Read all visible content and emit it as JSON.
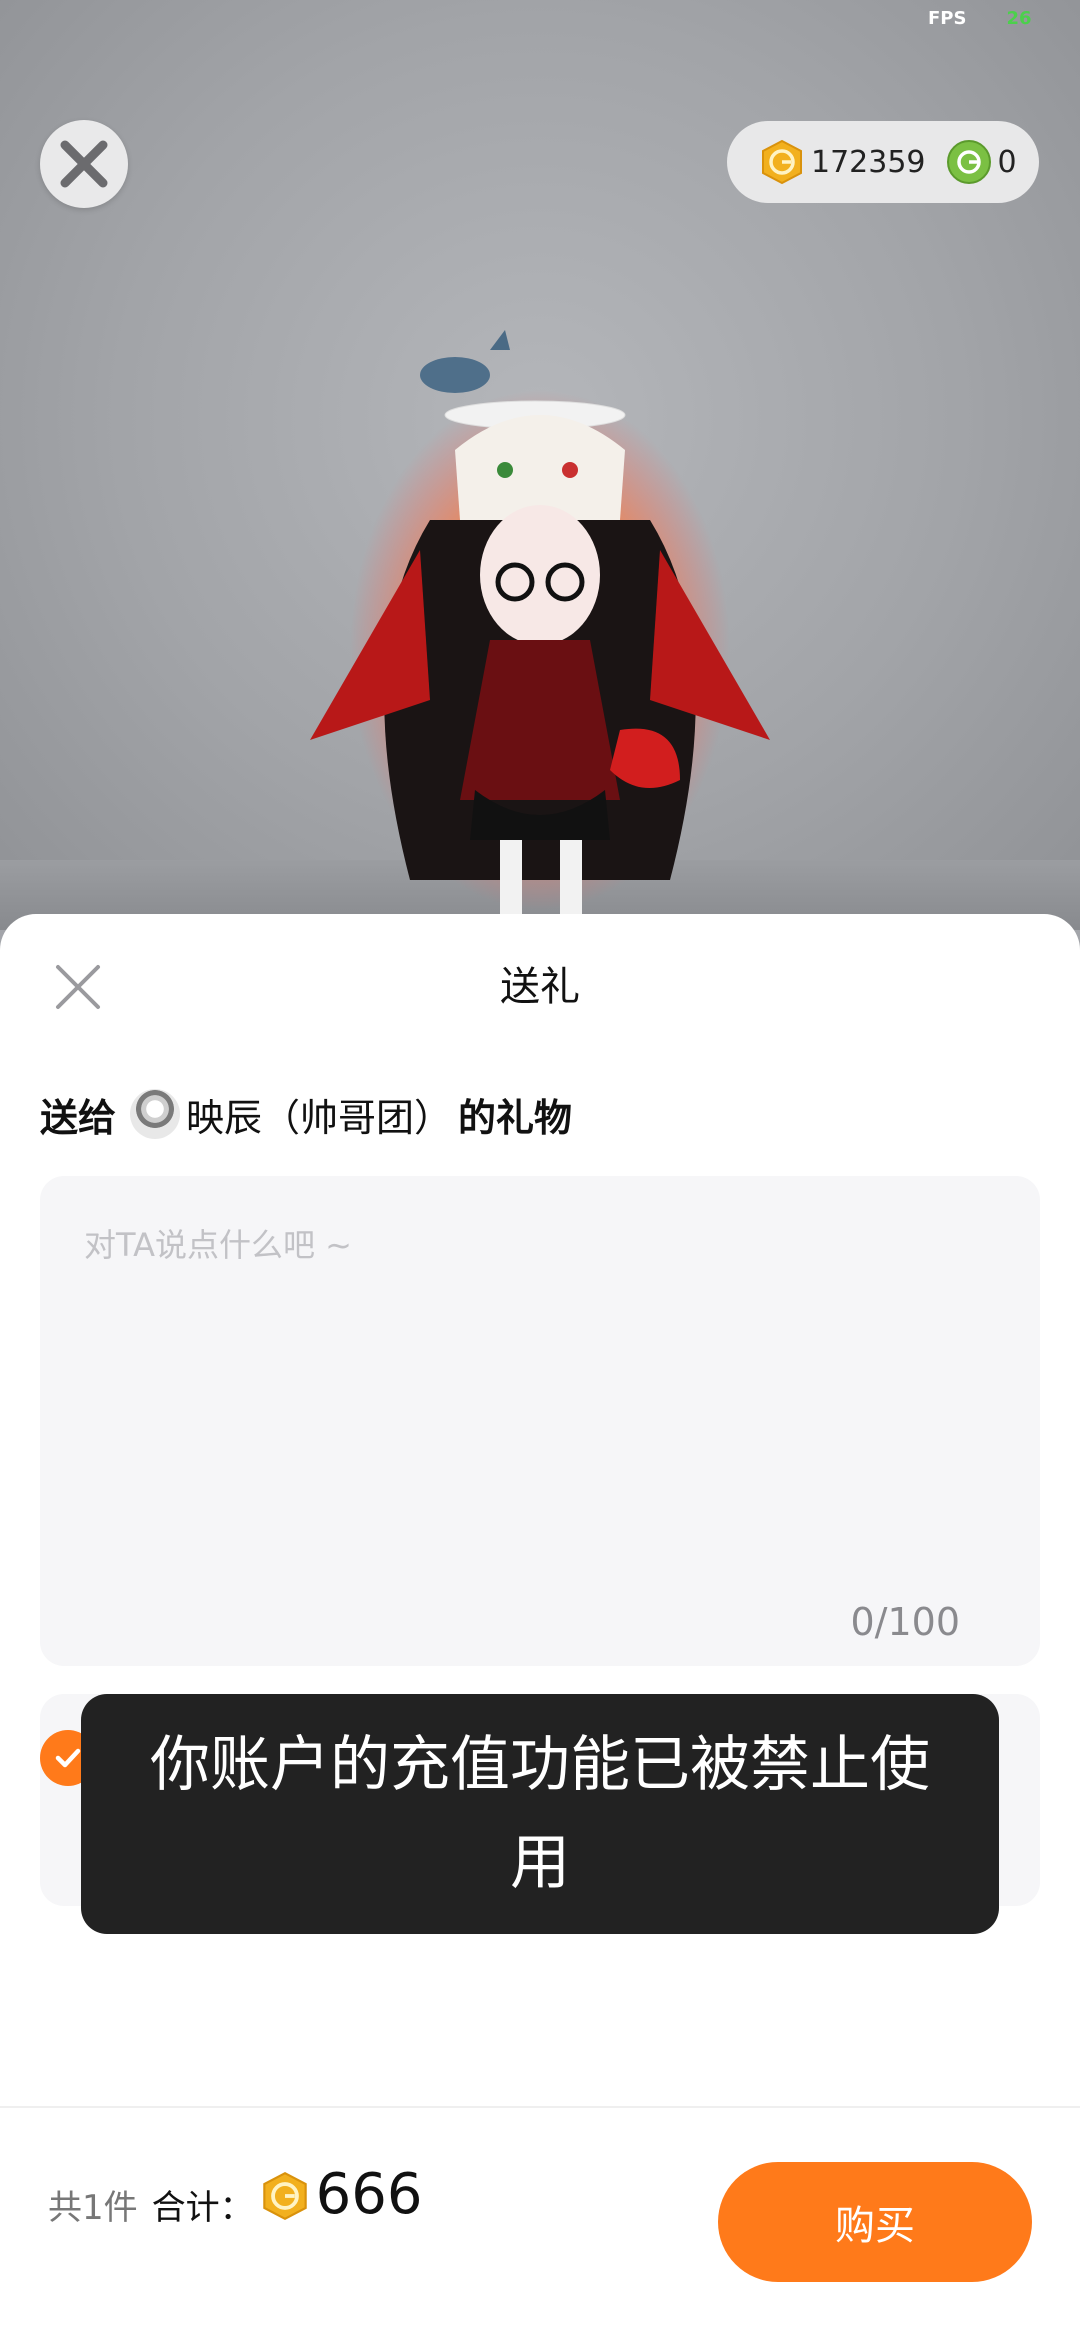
{
  "status": {
    "fps_label": "FPS",
    "fps_value": "26"
  },
  "wallet": {
    "gold_coins": "172359",
    "green_coins": "0"
  },
  "sheet": {
    "title": "送礼",
    "recipient_prefix": "送给",
    "recipient_name": "映辰（帅哥团）",
    "recipient_suffix": "的礼物",
    "message_placeholder": "对TA说点什么吧 ~",
    "message_value": "",
    "char_counter": "0/100"
  },
  "toast": {
    "message": "你账户的充值功能已被禁止使用"
  },
  "footer": {
    "item_count": "共1件",
    "total_label": "合计：",
    "total_amount": "666",
    "buy_label": "购买"
  },
  "colors": {
    "accent": "#ff7a1a",
    "gold_coin": "#f2b01e",
    "green_coin": "#7bc043",
    "toast_bg": "#222222"
  },
  "icons": {
    "close": "close-icon",
    "gold_coin": "gold-coin-icon",
    "green_coin": "green-coin-icon",
    "check": "check-icon"
  }
}
